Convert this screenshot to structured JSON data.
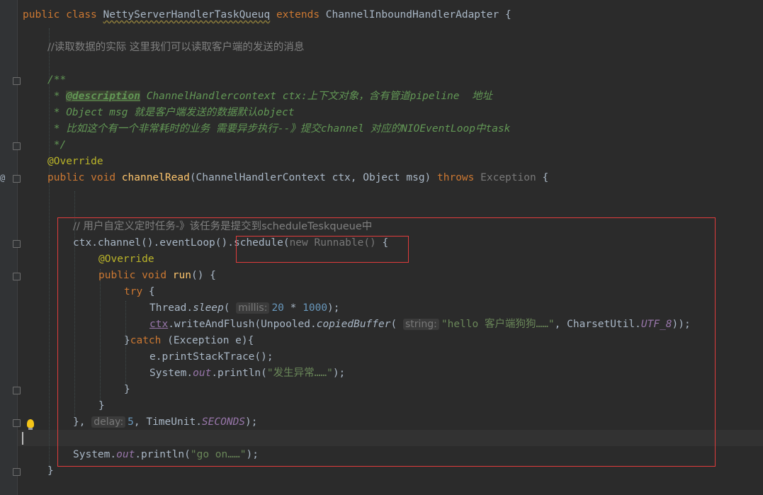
{
  "code": {
    "class_decl": {
      "kw1": "public",
      "kw2": "class",
      "name": "NettyServerHandlerTaskQueuq",
      "kw3": "extends",
      "parent": "ChannelInboundHandlerAdapter",
      "brace": " {"
    },
    "comment1": "//读取数据的实际 这里我们可以读取客户端的发送的消息",
    "doc": {
      "open": "/**",
      "l1_star": " * ",
      "l1_tag": "@description",
      "l1_rest": " ChannelHandlercontext ctx:上下文对象，含有管道pipeline  地址",
      "l2": " * Object msg 就是客户端发送的数据默认object",
      "l3": " * 比如这个有一个非常耗时的业务 需要异步执行--》提交channel 对应的NIOEventLoop中task",
      "close": " */"
    },
    "override1": "@Override",
    "method": {
      "kw1": "public",
      "kw2": "void",
      "name": "channelRead",
      "params": "(ChannelHandlerContext ctx, Object msg) ",
      "throws": "throws",
      "exc": " Exception",
      "brace": " {"
    },
    "comment2": "// 用户自定义定时任务-》该任务是提交到scheduleTeskqueue中",
    "schedule_line": {
      "pre": "ctx.channel().eventLoop().",
      "fn": "schedule(",
      "gray": "new Runnable()",
      "brace": " {"
    },
    "override2": "@Override",
    "run": {
      "kw1": "public",
      "kw2": "void",
      "name": "run",
      "rest": "() {"
    },
    "try": {
      "kw": "try",
      "rest": " {"
    },
    "sleep": {
      "pre": "Thread.",
      "fn": "sleep",
      "paren": "(",
      "hint": "millis:",
      "num1": "20",
      "op": " * ",
      "num2": "1000",
      "end": ");"
    },
    "write": {
      "ctx": "ctx",
      "pre": ".writeAndFlush(Unpooled.",
      "fn": "copiedBuffer",
      "paren": "(",
      "hint": "string:",
      "str": "\"hello 客户端狗狗……\"",
      "mid": ", CharsetUtil.",
      "const": "UTF_8",
      "end": "));"
    },
    "catch": {
      "brace": "}",
      "kw": "catch",
      "rest": " (Exception e){"
    },
    "print_stack": "e.printStackTrace();",
    "println1": {
      "pre": "System.",
      "out": "out",
      "mid": ".println(",
      "str": "\"发生异常……\"",
      "end": ");"
    },
    "close1": "}",
    "close2": "}",
    "schedule_end": {
      "pre": "},",
      "hint": "delay:",
      "num": "5",
      "mid": ", TimeUnit.",
      "const": "SECONDS",
      "end": ");"
    },
    "println2": {
      "pre": "System.",
      "out": "out",
      "mid": ".println(",
      "str": "\"go on……\"",
      "end": ");"
    },
    "close3": "}"
  },
  "gutter": {
    "override_marker": "@"
  }
}
